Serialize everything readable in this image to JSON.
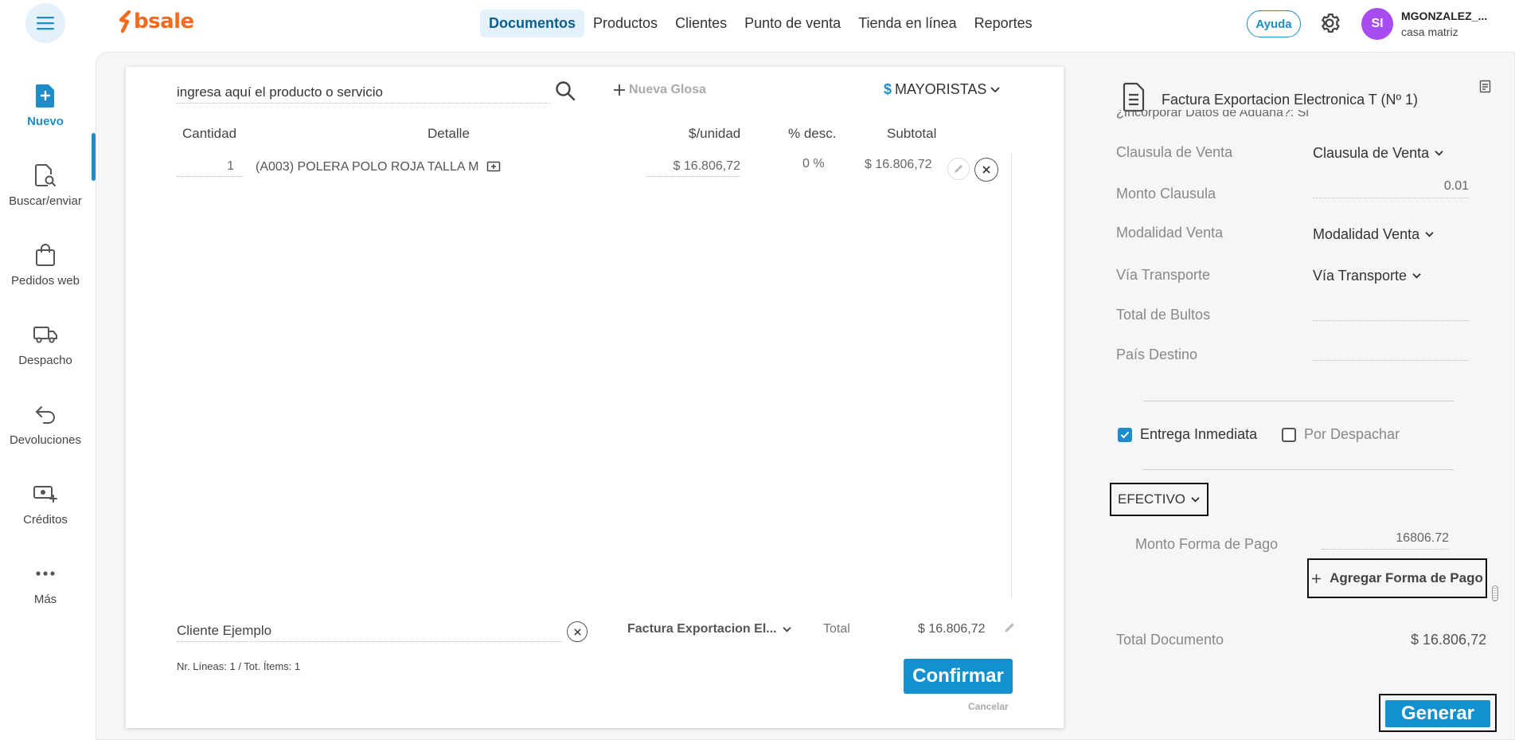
{
  "brand": {
    "logo_text": "bsale",
    "color": "#f26b1d"
  },
  "nav": {
    "items": [
      {
        "label": "Documentos",
        "active": true
      },
      {
        "label": "Productos"
      },
      {
        "label": "Clientes"
      },
      {
        "label": "Punto de venta"
      },
      {
        "label": "Tienda en línea"
      },
      {
        "label": "Reportes"
      }
    ]
  },
  "header": {
    "help_label": "Ayuda",
    "avatar_initials": "SI",
    "user_name": "MGONZALEZ_...",
    "branch": "casa matriz"
  },
  "sidebar": {
    "items": [
      {
        "label": "Nuevo",
        "icon": "new-document-icon",
        "active": true
      },
      {
        "label": "Buscar/enviar",
        "icon": "search-document-icon"
      },
      {
        "label": "Pedidos web",
        "icon": "shopping-bag-icon"
      },
      {
        "label": "Despacho",
        "icon": "truck-icon"
      },
      {
        "label": "Devoluciones",
        "icon": "return-arrow-icon"
      },
      {
        "label": "Créditos",
        "icon": "money-add-icon"
      },
      {
        "label": "Más",
        "icon": "more-dots-icon"
      }
    ]
  },
  "document": {
    "search_placeholder": "ingresa aquí el producto o servicio",
    "new_gloss_label": "Nueva Glosa",
    "price_list": {
      "currency_symbol": "$",
      "name": "MAYORISTAS"
    },
    "columns": {
      "qty": "Cantidad",
      "detail": "Detalle",
      "unit_price": "$/unidad",
      "discount": "% desc.",
      "subtotal": "Subtotal"
    },
    "rows": [
      {
        "qty": "1",
        "detail": "(A003) POLERA POLO ROJA TALLA M",
        "unit_price": "$ 16.806,72",
        "discount": "0 %",
        "subtotal": "$ 16.806,72"
      }
    ],
    "client": "Cliente Ejemplo",
    "doc_type": "Factura Exportacion El...",
    "total_label": "Total",
    "total_value": "$ 16.806,72",
    "lines_info": "Nr. Líneas: 1 / Tot. Ítems: 1",
    "confirm_label": "Confirmar",
    "cancel_label": "Cancelar"
  },
  "right_panel": {
    "title": "Factura Exportacion Electronica T (Nº 1)",
    "customs_question": "¿Incorporar Datos de Aduana?: Si",
    "fields": {
      "clausula_venta": {
        "label": "Clausula de Venta",
        "value": "Clausula de Venta"
      },
      "monto_clausula": {
        "label": "Monto Clausula",
        "value": "0.01"
      },
      "modalidad_venta": {
        "label": "Modalidad Venta",
        "value": "Modalidad Venta"
      },
      "via_transporte": {
        "label": "Vía Transporte",
        "value": "Vía Transporte"
      },
      "total_bultos": {
        "label": "Total de Bultos",
        "value": ""
      },
      "pais_destino": {
        "label": "País Destino",
        "value": ""
      }
    },
    "delivery": {
      "immediate": "Entrega Inmediata",
      "immediate_checked": true,
      "dispatch": "Por Despachar",
      "dispatch_checked": false
    },
    "payment_method": "EFECTIVO",
    "payment_amount_label": "Monto Forma de Pago",
    "payment_amount": "16806.72",
    "add_payment_label": "Agregar Forma de Pago",
    "total_doc_label": "Total Documento",
    "total_doc_value": "$ 16.806,72",
    "generate_label": "Generar"
  },
  "colors": {
    "accent": "#1391cf",
    "avatar": "#a64cf0"
  }
}
